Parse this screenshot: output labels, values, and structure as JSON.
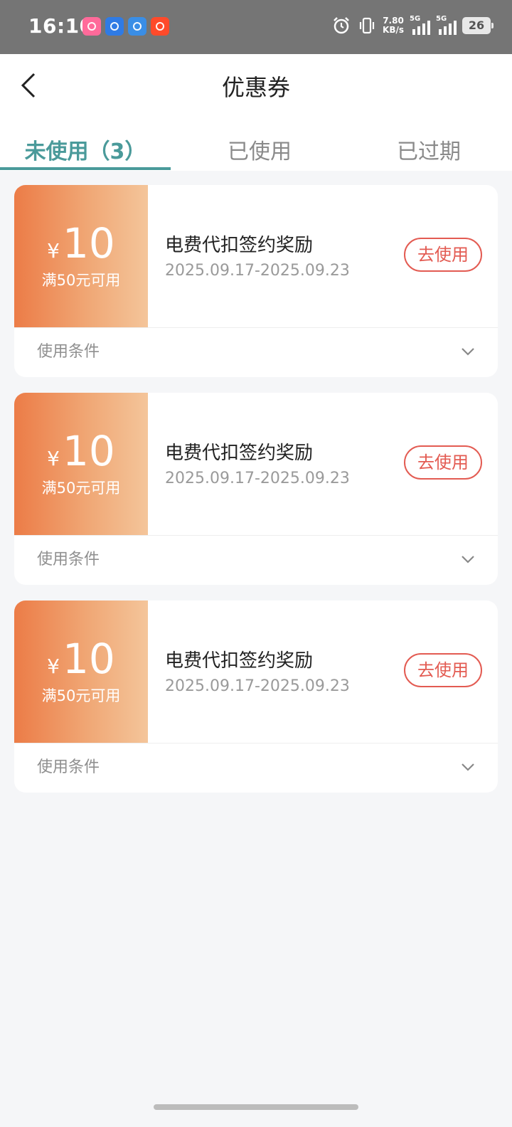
{
  "status_bar": {
    "time": "16:10",
    "speed_value": "7.80",
    "speed_unit": "KB/s",
    "network1": "5G",
    "network2": "5G",
    "battery": "26",
    "app_icons": [
      {
        "name": "bilibili-app-icon",
        "color": "#ff6a9a"
      },
      {
        "name": "blue-app-icon",
        "color": "#2f7be5"
      },
      {
        "name": "video-app-icon",
        "color": "#3a8ee6"
      },
      {
        "name": "taobao-app-icon",
        "color": "#ff4a2a"
      }
    ]
  },
  "header": {
    "back_icon": "chevron-left-icon",
    "title": "优惠券"
  },
  "tabs": [
    {
      "label": "未使用（3）",
      "active": true
    },
    {
      "label": "已使用",
      "active": false
    },
    {
      "label": "已过期",
      "active": false
    }
  ],
  "coupons": [
    {
      "currency": "¥",
      "amount": "10",
      "condition": "满50元可用",
      "name": "电费代扣签约奖励",
      "date_range": "2025.09.17-2025.09.23",
      "action_label": "去使用",
      "terms_label": "使用条件"
    },
    {
      "currency": "¥",
      "amount": "10",
      "condition": "满50元可用",
      "name": "电费代扣签约奖励",
      "date_range": "2025.09.17-2025.09.23",
      "action_label": "去使用",
      "terms_label": "使用条件"
    },
    {
      "currency": "¥",
      "amount": "10",
      "condition": "满50元可用",
      "name": "电费代扣签约奖励",
      "date_range": "2025.09.17-2025.09.23",
      "action_label": "去使用",
      "terms_label": "使用条件"
    }
  ],
  "colors": {
    "accent": "#4a9a9a",
    "coupon_orange": "#ec7c47",
    "action_red": "#e35b52"
  }
}
